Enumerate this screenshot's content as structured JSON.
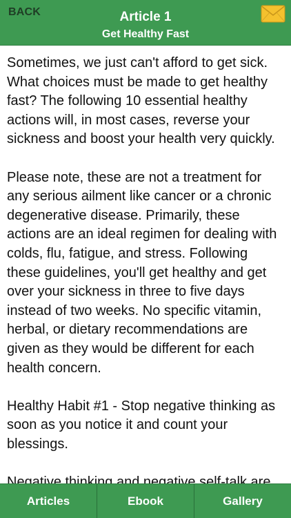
{
  "header": {
    "back_label": "BACK",
    "title": "Article 1",
    "subtitle": "Get Healthy Fast",
    "mail_icon": "envelope-icon"
  },
  "article": {
    "paragraphs": [
      "Sometimes, we just can't afford to get sick. What choices must be made to get healthy fast? The following 10 essential healthy actions will, in most cases, reverse your sickness and boost your health very quickly.",
      "Please note, these are not a treatment for any serious ailment like cancer or a chronic degenerative disease. Primarily, these actions are an ideal regimen for dealing with colds, flu, fatigue, and stress. Following these guidelines, you'll get healthy and get over your sickness in three to five days instead of two weeks. No specific vitamin, herbal, or dietary recommendations are given as they would be different for each health concern.",
      "Healthy Habit #1 - Stop negative thinking as soon as you notice it and count your blessings.",
      "Negative thinking and negative self-talk are"
    ]
  },
  "tabbar": {
    "tabs": [
      {
        "label": "Articles"
      },
      {
        "label": "Ebook"
      },
      {
        "label": "Gallery"
      }
    ]
  },
  "colors": {
    "bar_green": "#3e9a52",
    "back_text": "#1f3d25",
    "envelope": "#f5c12e"
  }
}
